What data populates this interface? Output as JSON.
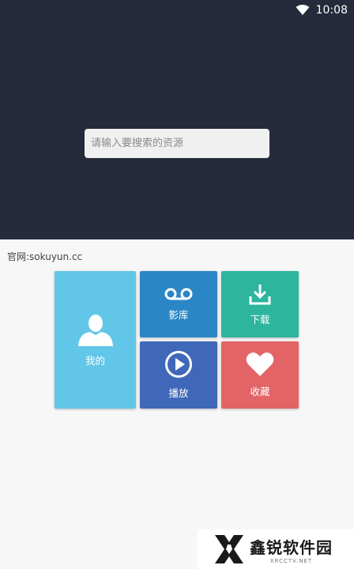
{
  "status_bar": {
    "time": "10:08"
  },
  "search": {
    "placeholder": "请输入要搜索的资源"
  },
  "site_label": "官网:sokuyun.cc",
  "tiles": {
    "mine": {
      "label": "我的",
      "color": "#62c6e8",
      "icon": "person-icon"
    },
    "library": {
      "label": "影库",
      "color": "#2b86c6",
      "icon": "voicemail-icon"
    },
    "download": {
      "label": "下载",
      "color": "#2db59e",
      "icon": "download-icon"
    },
    "play": {
      "label": "播放",
      "color": "#3f68b8",
      "icon": "play-circle-icon"
    },
    "favorite": {
      "label": "收藏",
      "color": "#e26467",
      "icon": "heart-icon"
    }
  },
  "watermark": {
    "main": "鑫锐软件园",
    "sub": "XRCCTV.NET"
  },
  "colors": {
    "header_bg": "#252b3b",
    "page_bg": "#f7f7f7"
  }
}
